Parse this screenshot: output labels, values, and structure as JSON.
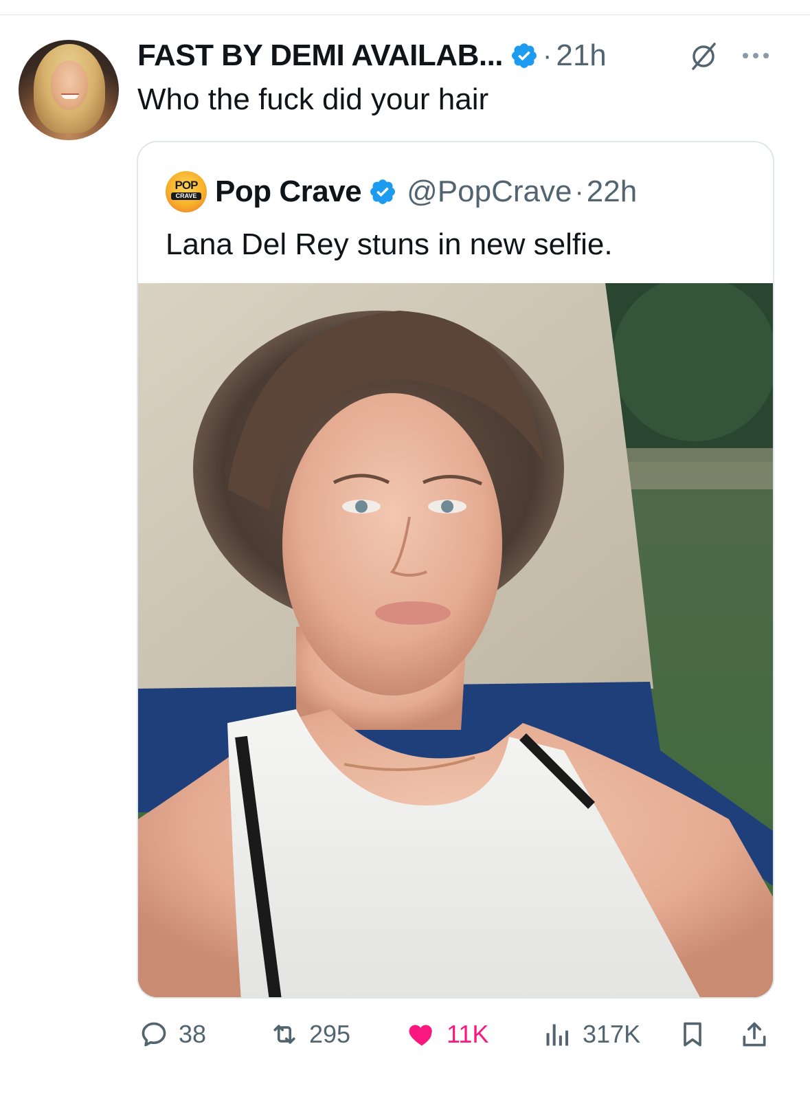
{
  "tweet": {
    "display_name": "FAST BY DEMI AVAILAB...",
    "separator": "·",
    "time": "21h",
    "text": "Who the fuck did your hair"
  },
  "quote": {
    "display_name": "Pop Crave",
    "handle": "@PopCrave",
    "separator": "·",
    "time": "22h",
    "text": "Lana Del Rey stuns in new selfie.",
    "avatar_logo_top": "POP",
    "avatar_logo_bottom": "CRAVE"
  },
  "actions": {
    "replies": "38",
    "reposts": "295",
    "likes": "11K",
    "views": "317K"
  },
  "icons": {
    "verified": "verified-badge-icon",
    "grok": "grok-icon",
    "more": "more-icon",
    "reply": "reply-icon",
    "repost": "repost-icon",
    "like": "heart-icon",
    "views": "views-icon",
    "bookmark": "bookmark-icon",
    "share": "share-icon"
  },
  "colors": {
    "text": "#0f1419",
    "secondary": "#536471",
    "verified_blue": "#1d9bf0",
    "like_pink": "#f91880",
    "border": "#e1e6ea"
  }
}
